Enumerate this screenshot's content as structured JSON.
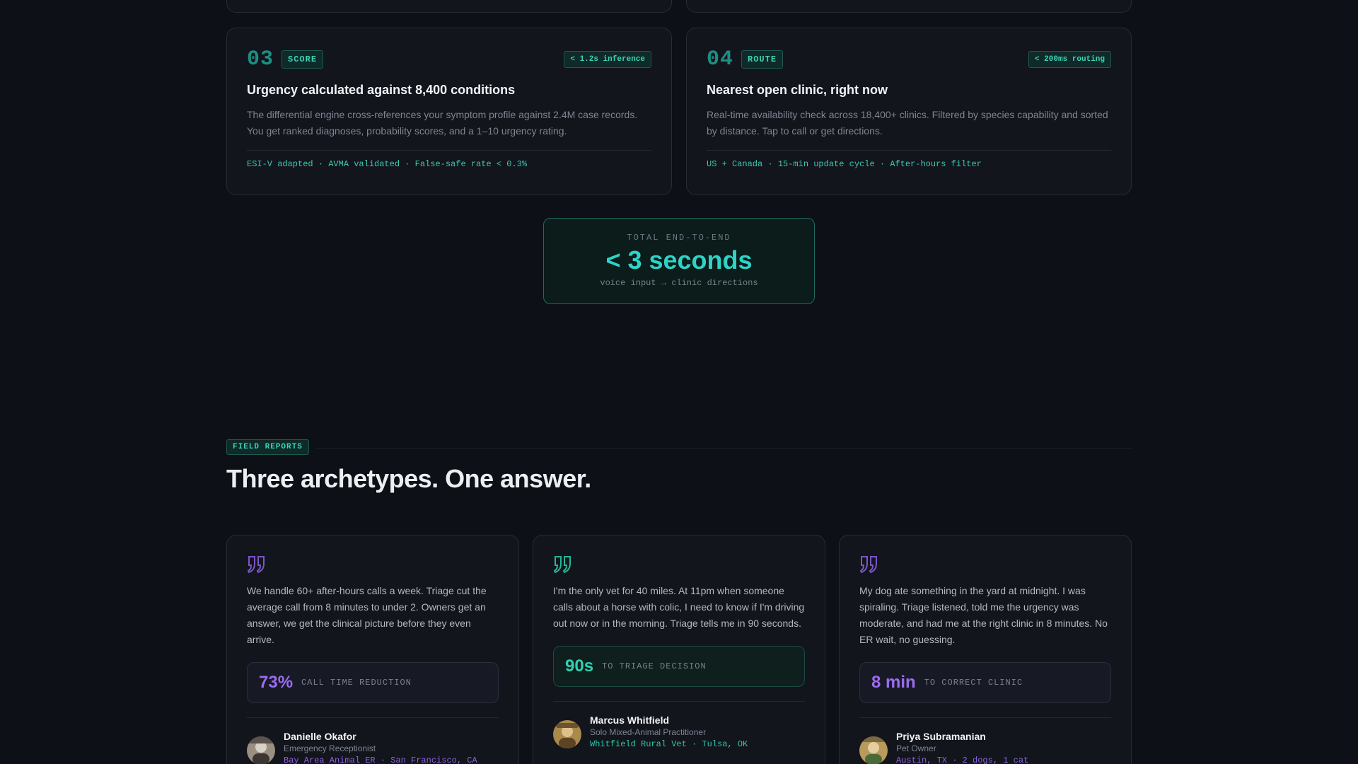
{
  "steps": [
    {
      "number": "03",
      "tag": "SCORE",
      "badge": "< 1.2s inference",
      "title": "Urgency calculated against 8,400 conditions",
      "description": "The differential engine cross-references your symptom profile against 2.4M case records. You get ranked diagnoses, probability scores, and a 1–10 urgency rating.",
      "meta": "ESI-V adapted · AVMA validated · False-safe rate < 0.3%"
    },
    {
      "number": "04",
      "tag": "ROUTE",
      "badge": "< 200ms routing",
      "title": "Nearest open clinic, right now",
      "description": "Real-time availability check across 18,400+ clinics. Filtered by species capability and sorted by distance. Tap to call or get directions.",
      "meta": "US + Canada · 15-min update cycle · After-hours filter"
    }
  ],
  "total": {
    "label": "TOTAL END-TO-END",
    "value": "< 3 seconds",
    "sub": "voice input → clinic directions"
  },
  "section": {
    "tag": "FIELD REPORTS",
    "title": "Three archetypes. One answer."
  },
  "testimonials": [
    {
      "quote": "We handle 60+ after-hours calls a week. Triage cut the average call from 8 minutes to under 2. Owners get an answer, we get the clinical picture before they even arrive.",
      "stat_value": "73%",
      "stat_label": "CALL TIME REDUCTION",
      "accent": "#9b6cf0",
      "name": "Danielle Okafor",
      "role": "Emergency Receptionist",
      "location": "Bay Area Animal ER · San Francisco, CA"
    },
    {
      "quote": "I'm the only vet for 40 miles. At 11pm when someone calls about a horse with colic, I need to know if I'm driving out now or in the morning. Triage tells me in 90 seconds.",
      "stat_value": "90s",
      "stat_label": "TO TRIAGE DECISION",
      "accent": "#2ed3b0",
      "name": "Marcus Whitfield",
      "role": "Solo Mixed-Animal Practitioner",
      "location": "Whitfield Rural Vet · Tulsa, OK"
    },
    {
      "quote": "My dog ate something in the yard at midnight. I was spiraling. Triage listened, told me the urgency was moderate, and had me at the right clinic in 8 minutes. No ER wait, no guessing.",
      "stat_value": "8 min",
      "stat_label": "TO CORRECT CLINIC",
      "accent": "#9b6cf0",
      "name": "Priya Subramanian",
      "role": "Pet Owner",
      "location": "Austin, TX · 2 dogs, 1 cat"
    }
  ],
  "icons": {
    "quote": "quote-icon",
    "avatar": "avatar-photo"
  },
  "colors": {
    "background": "#0d1016",
    "teal_accent": "#2ed3c8",
    "purple_accent": "#9b6cf0"
  }
}
